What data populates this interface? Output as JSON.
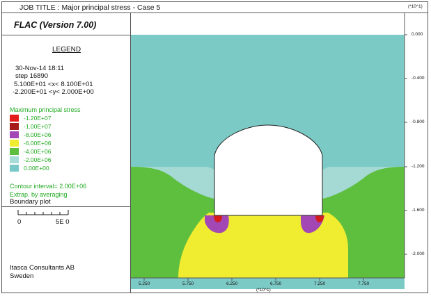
{
  "header": {
    "job_title": "JOB TITLE : Major principal stress  -  Case 5",
    "y_scale": "(*10^1)"
  },
  "sidebar": {
    "program_version": "FLAC (Version 7.00)",
    "legend_heading": "LEGEND",
    "date_time": "30-Nov-14  18:11",
    "step": "step    16890",
    "x_range": "5.100E+01 <x< 8.100E+01",
    "y_range": "-2.200E+01 <y< 2.000E+00",
    "stress_title": "Maximum principal stress",
    "contours": [
      {
        "label": "-1.20E+07",
        "color": "#e31b1b"
      },
      {
        "label": "-1.00E+07",
        "color": "#a61a1a"
      },
      {
        "label": "-8.00E+06",
        "color": "#a347b5"
      },
      {
        "label": "-6.00E+06",
        "color": "#f0ec2f"
      },
      {
        "label": "-4.00E+06",
        "color": "#5ebf3e"
      },
      {
        "label": "-2.00E+06",
        "color": "#a8dcd6"
      },
      {
        "label": "0.00E+00",
        "color": "#78c8c8"
      }
    ],
    "contour_interval": "Contour interval=  2.00E+06",
    "extrapolation": "Extrap. by averaging",
    "boundary_plot": "Boundary plot",
    "scale_zero": "0",
    "scale_value": "5E  0",
    "company": "Itasca Consultants AB",
    "country": "Sweden"
  },
  "plot": {
    "y_ticks": [
      "0.000",
      "-0.400",
      "-0.800",
      "-1.200",
      "-1.600",
      "-2.000"
    ],
    "x_ticks": [
      "5.250",
      "5.750",
      "6.250",
      "6.750",
      "7.250",
      "7.750"
    ],
    "x_scale": "(*10^1)",
    "colors": {
      "background_teal": "#7ccac6",
      "light_teal": "#a5d9d4",
      "green": "#5ebf3e",
      "yellow": "#f0ec2f",
      "purple": "#a347b5",
      "red": "#d41c1c",
      "tunnel": "#ffffff"
    }
  }
}
